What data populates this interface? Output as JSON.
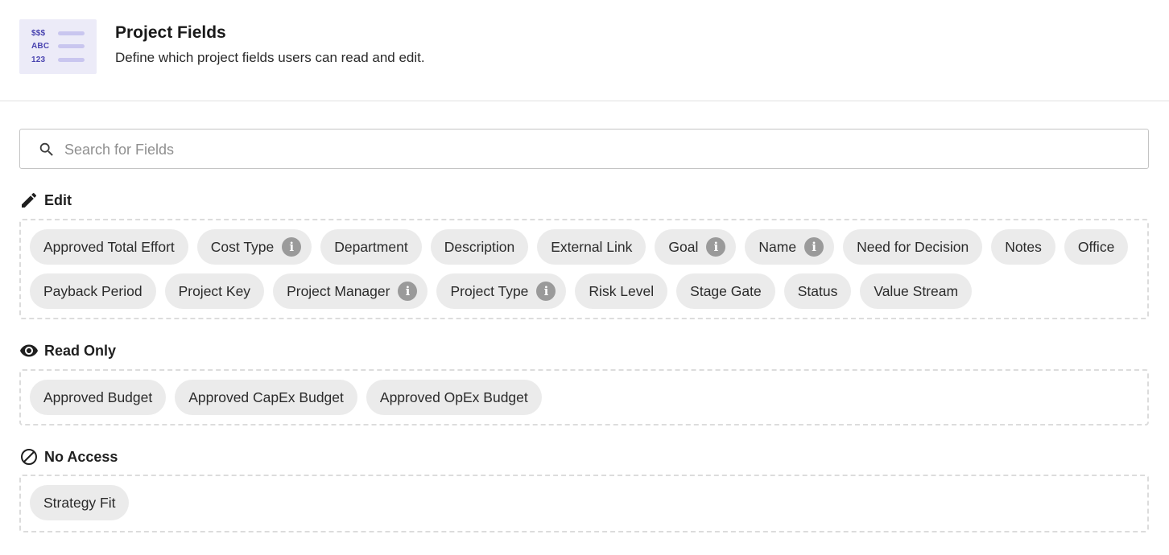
{
  "header": {
    "icon_lines": [
      "$$$",
      "ABC",
      "123"
    ],
    "title": "Project Fields",
    "subtitle": "Define which project fields users can read and edit."
  },
  "search": {
    "placeholder": "Search for Fields",
    "value": ""
  },
  "sections": {
    "edit": {
      "title": "Edit",
      "icon": "pencil-icon",
      "fields": [
        {
          "label": "Approved Total Effort",
          "info": false
        },
        {
          "label": "Cost Type",
          "info": true
        },
        {
          "label": "Department",
          "info": false
        },
        {
          "label": "Description",
          "info": false
        },
        {
          "label": "External Link",
          "info": false
        },
        {
          "label": "Goal",
          "info": true
        },
        {
          "label": "Name",
          "info": true
        },
        {
          "label": "Need for Decision",
          "info": false
        },
        {
          "label": "Notes",
          "info": false
        },
        {
          "label": "Office",
          "info": false
        },
        {
          "label": "Payback Period",
          "info": false
        },
        {
          "label": "Project Key",
          "info": false
        },
        {
          "label": "Project Manager",
          "info": true
        },
        {
          "label": "Project Type",
          "info": true
        },
        {
          "label": "Risk Level",
          "info": false
        },
        {
          "label": "Stage Gate",
          "info": false
        },
        {
          "label": "Status",
          "info": false
        },
        {
          "label": "Value Stream",
          "info": false
        }
      ]
    },
    "read_only": {
      "title": "Read Only",
      "icon": "eye-icon",
      "fields": [
        {
          "label": "Approved Budget",
          "info": false
        },
        {
          "label": "Approved CapEx Budget",
          "info": false
        },
        {
          "label": "Approved OpEx Budget",
          "info": false
        }
      ]
    },
    "no_access": {
      "title": "No Access",
      "icon": "block-icon",
      "fields": [
        {
          "label": "Strategy Fit",
          "info": false
        }
      ]
    }
  },
  "info_glyph": "i",
  "colors": {
    "accent": "#4a44b0",
    "chip_bg": "#ebebeb",
    "info_icon": "#9a9a9a",
    "dashed_border": "#dcdcdc"
  }
}
